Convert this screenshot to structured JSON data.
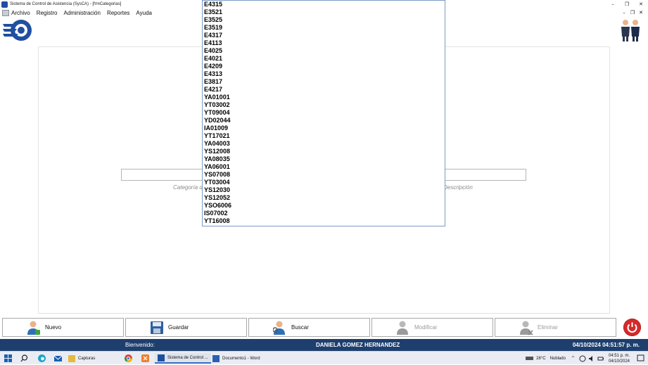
{
  "window": {
    "title": "Sistema de Control de Asistencia (SysCA) - [frmCategorias]",
    "controls": [
      "–",
      "❐",
      "✕"
    ]
  },
  "menu": {
    "items": [
      "Archivo",
      "Registro",
      "Administración",
      "Reportes",
      "Ayuda"
    ],
    "mdi_controls": [
      "–",
      "❐",
      "✕"
    ]
  },
  "form": {
    "left_hint": "Categoría de",
    "right_hint": "Descripción"
  },
  "dropdown": {
    "options": [
      "E4315",
      "E3521",
      "E3525",
      "E3519",
      "E4317",
      "E4113",
      "E4025",
      "E4021",
      "E4209",
      "E4313",
      "E3817",
      "E4217",
      "YA01001",
      "YT03002",
      "YT09004",
      "YD02044",
      "IA01009",
      "YT17021",
      "YA04003",
      "YS12008",
      "YA08035",
      "YA06001",
      "YS07008",
      "YT03004",
      "YS12030",
      "YS12052",
      "YSO6006",
      "IS07002",
      "YT16008"
    ]
  },
  "actions": {
    "nuevo": "Nuevo",
    "guardar": "Guardar",
    "buscar": "Buscar",
    "modificar": "Modificar",
    "eliminar": "Eliminar"
  },
  "status": {
    "welcome": "Bienvenido:",
    "user": "DANIELA GOMEZ HERNANDEZ",
    "datetime": "04/10/2024 04:51:57 p. m."
  },
  "taskbar": {
    "capturas": "Capturas",
    "app": "Sistema de Control ...",
    "word": "Documento1 - Word",
    "temperature": "28°C",
    "weather": "Nublado",
    "time": "04:51 p. m.",
    "date": "04/10/2024"
  },
  "colors": {
    "status_bar": "#1e3f6e",
    "accent": "#3a6fc4",
    "power": "#d42a2a"
  }
}
